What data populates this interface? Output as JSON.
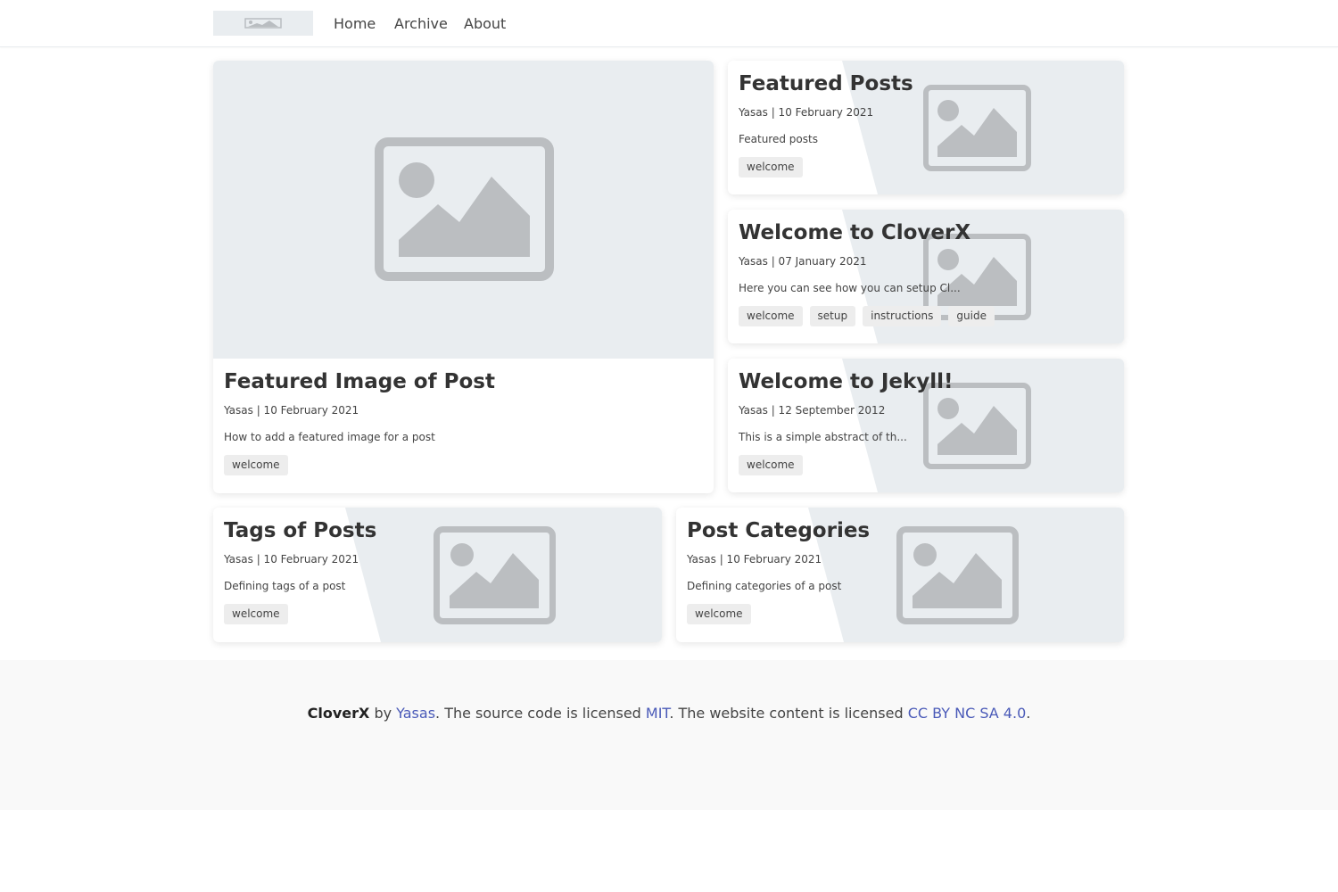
{
  "nav": {
    "logo": "logo-icon",
    "links": [
      "Home",
      "Archive",
      "About"
    ]
  },
  "posts": [
    {
      "title": "Featured Image of Post",
      "meta": "Yasas | 10 February 2021",
      "excerpt": "How to add a featured image for a post",
      "tags": [
        "welcome"
      ],
      "icon": "image-placeholder-icon"
    },
    {
      "title": "Featured Posts",
      "meta": "Yasas | 10 February 2021",
      "excerpt": "Featured posts",
      "tags": [
        "welcome"
      ],
      "icon": "image-placeholder-icon"
    },
    {
      "title": "Welcome to CloverX",
      "meta": "Yasas | 07 January 2021",
      "excerpt": "Here you can see how you can setup Cl...",
      "tags": [
        "welcome",
        "setup",
        "instructions",
        "guide"
      ],
      "icon": "image-placeholder-icon"
    },
    {
      "title": "Welcome to Jekyll!",
      "meta": "Yasas | 12 September 2012",
      "excerpt": "This is a simple abstract of th...",
      "tags": [
        "welcome"
      ],
      "icon": "image-placeholder-icon"
    },
    {
      "title": "Tags of Posts",
      "meta": "Yasas | 10 February 2021",
      "excerpt": "Defining tags of a post",
      "tags": [
        "welcome"
      ],
      "icon": "image-placeholder-icon"
    },
    {
      "title": "Post Categories",
      "meta": "Yasas | 10 February 2021",
      "excerpt": "Defining categories of a post",
      "tags": [
        "welcome"
      ],
      "icon": "image-placeholder-icon"
    }
  ],
  "footer": {
    "brand": "CloverX",
    "by": " by ",
    "author": "Yasas",
    "text1": ". The source code is licensed ",
    "license_code": "MIT",
    "text2": ". The website content is licensed ",
    "license_content": "CC BY NC SA 4.0",
    "text3": "."
  },
  "colors": {
    "placeholder_bg": "#e9edf0",
    "placeholder_icon": "#bbbec1",
    "link": "#4a5ab8",
    "footer_bg": "#f9f9f9"
  }
}
